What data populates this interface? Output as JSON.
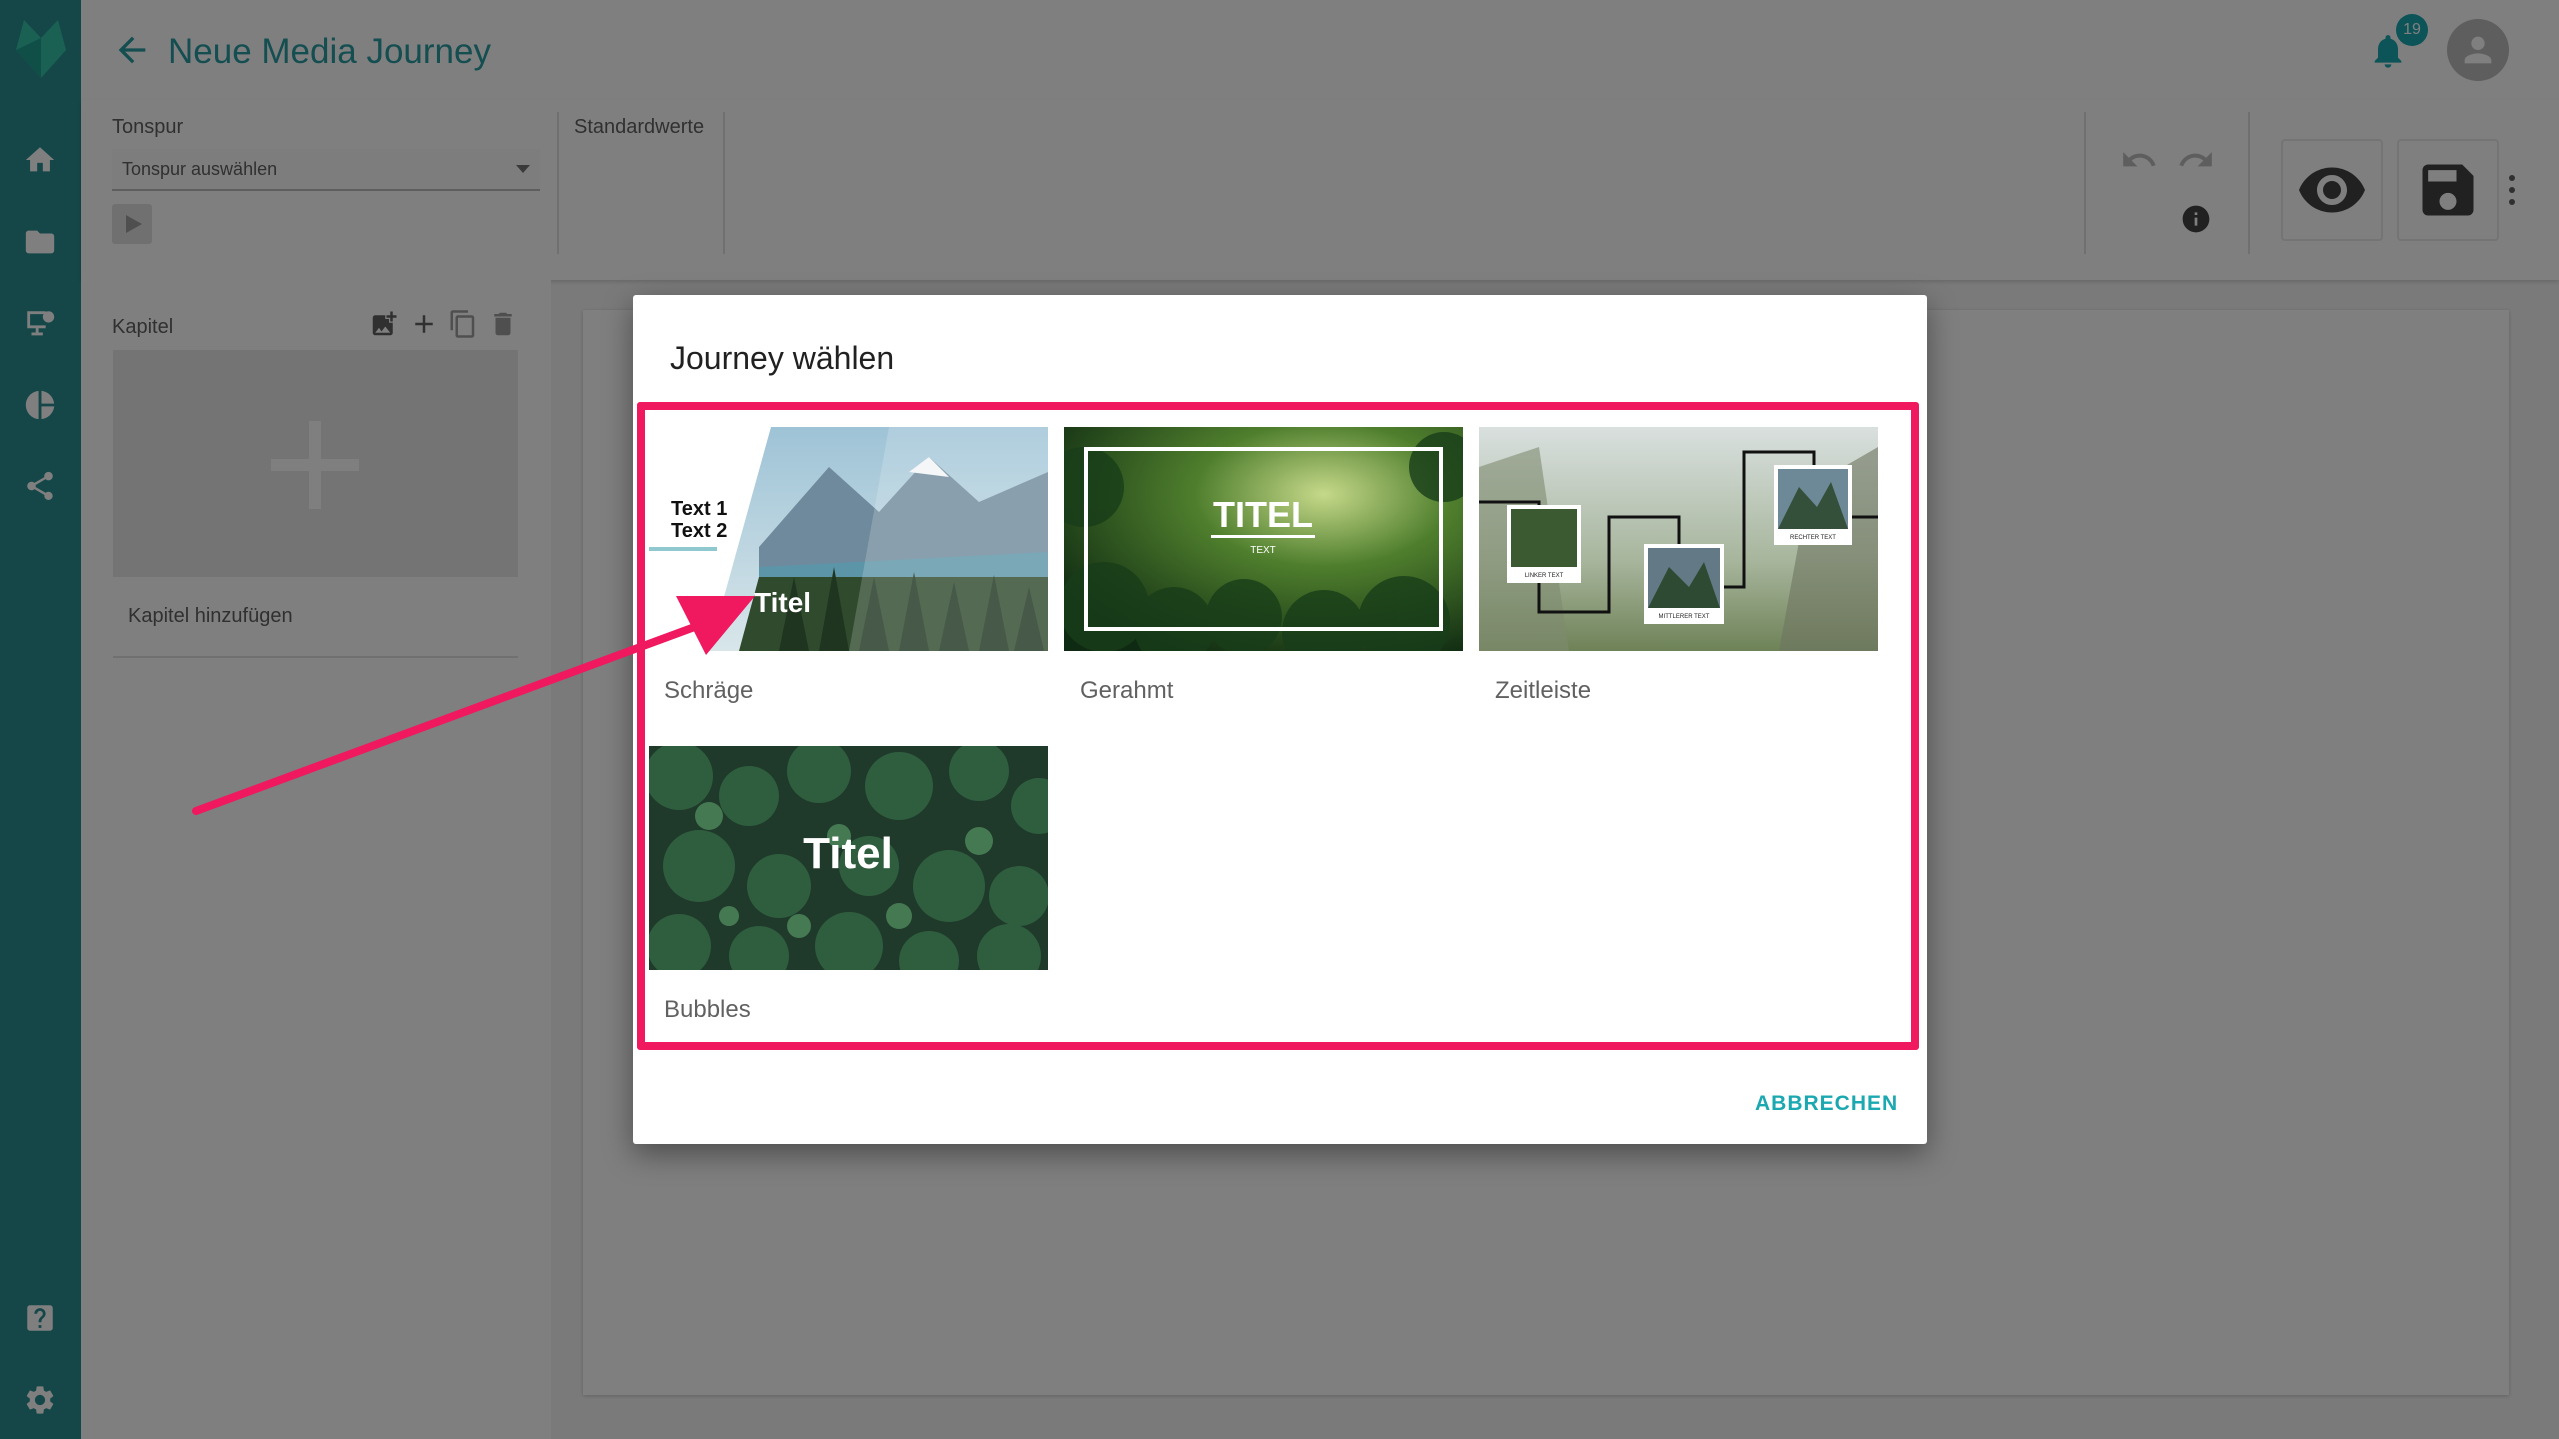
{
  "header": {
    "title": "Neue Media Journey",
    "notification_count": "19"
  },
  "toolbar": {
    "tonspur_label": "Tonspur",
    "tonspur_placeholder": "Tonspur auswählen",
    "standardwerte_label": "Standardwerte"
  },
  "chapters": {
    "label": "Kapitel",
    "add_label": "Kapitel hinzufügen"
  },
  "dialog": {
    "title": "Journey wählen",
    "cancel_label": "ABBRECHEN",
    "templates": [
      {
        "name": "Schräge",
        "thumb_text_1": "Text 1",
        "thumb_text_2": "Text 2",
        "thumb_title": "Titel"
      },
      {
        "name": "Gerahmt",
        "thumb_title": "TITEL",
        "thumb_sub": "TEXT"
      },
      {
        "name": "Zeitleiste",
        "thumb_left": "LINKER TEXT",
        "thumb_mid": "MITTLERER TEXT",
        "thumb_right": "RECHTER TEXT"
      },
      {
        "name": "Bubbles",
        "thumb_title": "Titel"
      }
    ]
  },
  "colors": {
    "brand_teal": "#2a8f93",
    "accent": "#1ba8b0",
    "highlight": "#f0185e"
  }
}
